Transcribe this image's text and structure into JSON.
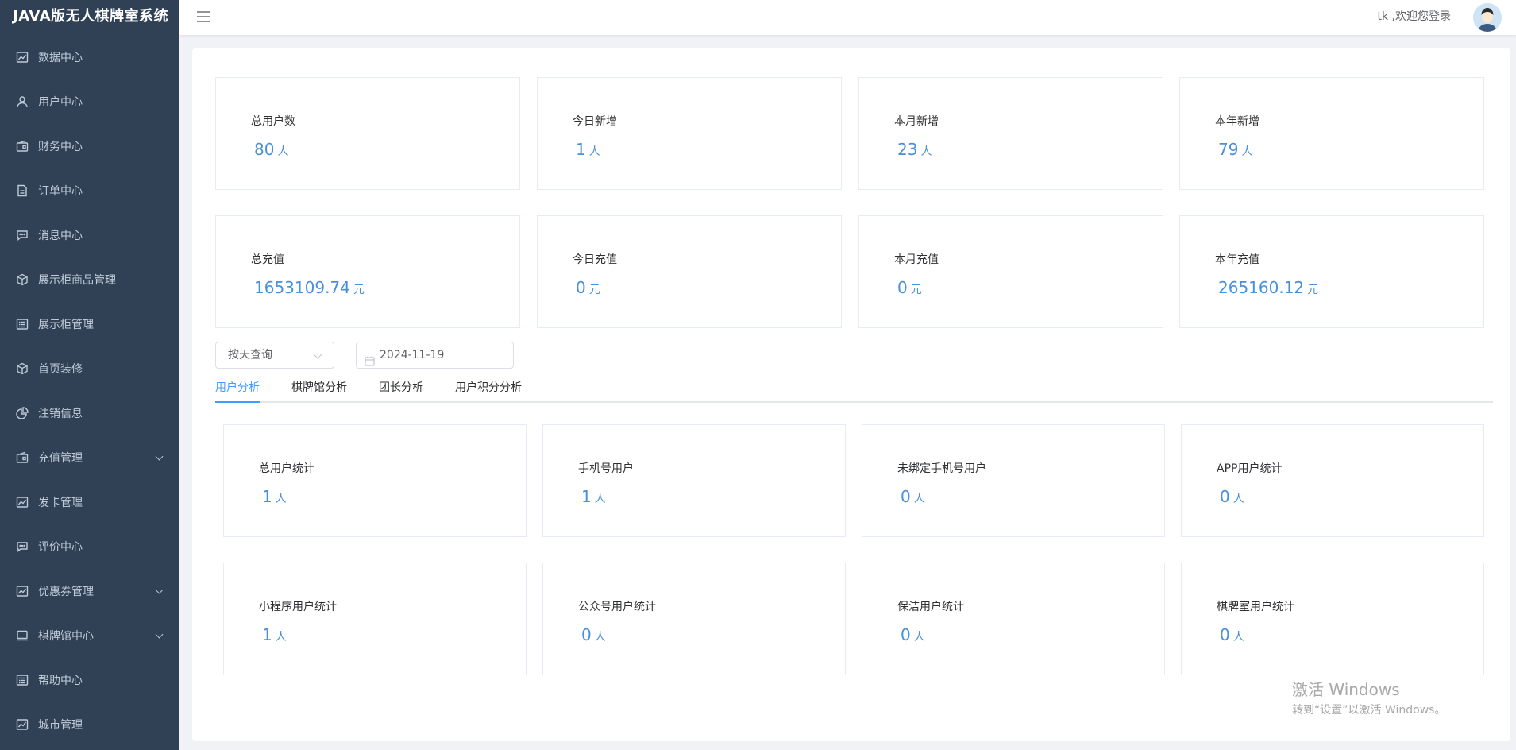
{
  "app": {
    "title": "JAVA版无人棋牌室系统"
  },
  "sidebar": {
    "items": [
      {
        "label": "数据中心",
        "icon": "chart-line-icon"
      },
      {
        "label": "用户中心",
        "icon": "user-icon"
      },
      {
        "label": "财务中心",
        "icon": "wallet-icon"
      },
      {
        "label": "订单中心",
        "icon": "document-icon"
      },
      {
        "label": "消息中心",
        "icon": "message-icon"
      },
      {
        "label": "展示柜商品管理",
        "icon": "box-icon"
      },
      {
        "label": "展示柜管理",
        "icon": "list-icon"
      },
      {
        "label": "首页装修",
        "icon": "box-icon"
      },
      {
        "label": "注销信息",
        "icon": "pie-chart-icon"
      },
      {
        "label": "充值管理",
        "icon": "wallet-icon",
        "expandable": true
      },
      {
        "label": "发卡管理",
        "icon": "chart-line-icon"
      },
      {
        "label": "评价中心",
        "icon": "message-icon"
      },
      {
        "label": "优惠券管理",
        "icon": "chart-line-icon",
        "expandable": true
      },
      {
        "label": "棋牌馆中心",
        "icon": "monitor-icon",
        "expandable": true
      },
      {
        "label": "帮助中心",
        "icon": "list-icon"
      },
      {
        "label": "城市管理",
        "icon": "chart-line-icon"
      }
    ]
  },
  "header": {
    "greeting": "tk ,欢迎您登录"
  },
  "stats_top": [
    {
      "label": "总用户数",
      "value": "80",
      "unit": "人"
    },
    {
      "label": "今日新增",
      "value": "1",
      "unit": "人"
    },
    {
      "label": "本月新增",
      "value": "23",
      "unit": "人"
    },
    {
      "label": "本年新增",
      "value": "79",
      "unit": "人"
    },
    {
      "label": "总充值",
      "value": "1653109.74",
      "unit": "元"
    },
    {
      "label": "今日充值",
      "value": "0",
      "unit": "元"
    },
    {
      "label": "本月充值",
      "value": "0",
      "unit": "元"
    },
    {
      "label": "本年充值",
      "value": "265160.12",
      "unit": "元"
    }
  ],
  "filters": {
    "query_mode": "按天查询",
    "date": "2024-11-19"
  },
  "tabs": [
    {
      "label": "用户分析",
      "active": true
    },
    {
      "label": "棋牌馆分析"
    },
    {
      "label": "团长分析"
    },
    {
      "label": "用户积分分析"
    }
  ],
  "stats_user": [
    {
      "label": "总用户统计",
      "value": "1",
      "unit": "人"
    },
    {
      "label": "手机号用户",
      "value": "1",
      "unit": "人"
    },
    {
      "label": "未绑定手机号用户",
      "value": "0",
      "unit": "人"
    },
    {
      "label": "APP用户统计",
      "value": "0",
      "unit": "人"
    },
    {
      "label": "小程序用户统计",
      "value": "1",
      "unit": "人"
    },
    {
      "label": "公众号用户统计",
      "value": "0",
      "unit": "人"
    },
    {
      "label": "保洁用户统计",
      "value": "0",
      "unit": "人"
    },
    {
      "label": "棋牌室用户统计",
      "value": "0",
      "unit": "人"
    }
  ],
  "watermark": {
    "line1": "激活 Windows",
    "line2": "转到“设置”以激活 Windows。"
  },
  "colors": {
    "sidebar_bg": "#304156",
    "accent": "#409eff",
    "value_blue": "#4a8fd9"
  }
}
